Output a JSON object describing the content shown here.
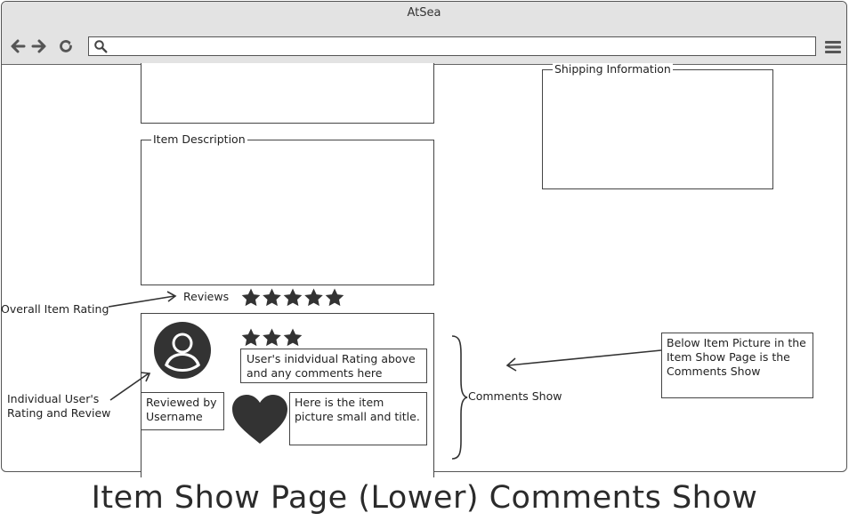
{
  "window": {
    "title": "AtSea"
  },
  "toolbar": {
    "back_icon": "arrow-left-icon",
    "forward_icon": "arrow-right-icon",
    "refresh_icon": "refresh-icon",
    "search_icon": "search-icon",
    "menu_icon": "hamburger-menu-icon",
    "url_value": ""
  },
  "panels": {
    "item_description": "Item Description",
    "shipping_information": "Shipping Information"
  },
  "reviews": {
    "label": "Reviews",
    "overall_rating": 5,
    "user_rating": 3,
    "user_comment": "User's  inidvidual Rating above and any comments here",
    "reviewed_by": "Reviewed by Username",
    "item_note": "Here is the item picture small and title."
  },
  "annotations": {
    "overall_item_rating": "Overall Item Rating",
    "individual_user": "Individual User's Rating and Review",
    "comments_show": "Comments Show",
    "below_item_picture": "Below Item Picture in the Item Show Page is the Comments Show"
  },
  "caption": "Item Show Page (Lower) Comments Show"
}
